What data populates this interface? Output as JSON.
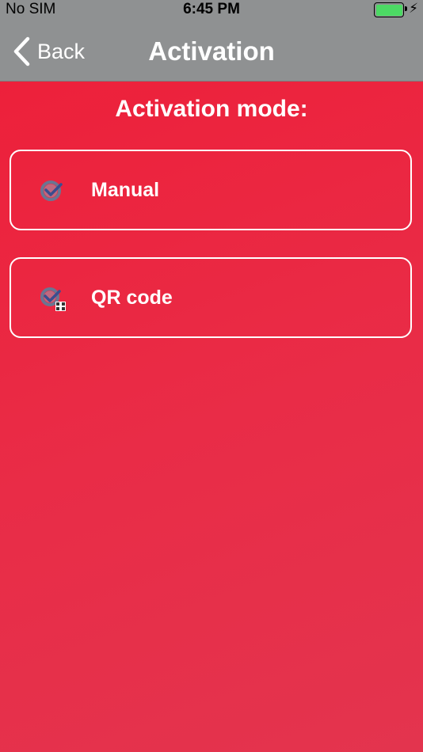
{
  "status_bar": {
    "carrier": "No SIM",
    "time": "6:45 PM",
    "battery_level": 1.0,
    "battery_color": "#4cd964",
    "charging_icon": "lightning-bolt-icon"
  },
  "nav": {
    "back_label": "Back",
    "back_icon": "chevron-left-icon",
    "title": "Activation",
    "bar_color": "#8f9192"
  },
  "main": {
    "section_title": "Activation mode:",
    "background_color": "#ea2440",
    "options": [
      {
        "label": "Manual",
        "icon": "check-badge-icon"
      },
      {
        "label": "QR code",
        "icon": "qr-check-badge-icon"
      }
    ]
  }
}
